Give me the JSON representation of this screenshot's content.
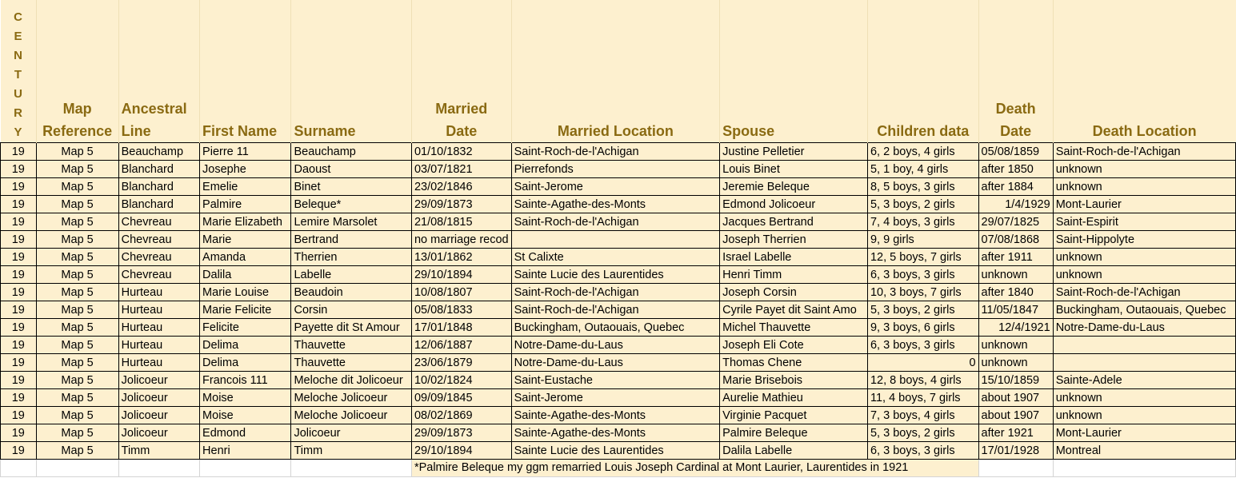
{
  "header": {
    "century_letters": [
      "C",
      "E",
      "N",
      "T",
      "U",
      "R",
      "Y"
    ],
    "map_reference": [
      "Map",
      "Reference"
    ],
    "ancestral_line": [
      "Ancestral",
      "Line"
    ],
    "first_name": "First Name",
    "surname": "Surname",
    "married_date": [
      "Married",
      "Date"
    ],
    "married_location": "Married Location",
    "spouse": "Spouse",
    "children_data": "Children data",
    "death_date": [
      "Death",
      "Date"
    ],
    "death_location": "Death Location"
  },
  "rows": [
    {
      "century": "19",
      "map": "Map 5",
      "line": "Beauchamp",
      "first": "Pierre 11",
      "surname": "Beauchamp",
      "mdate": "01/10/1832",
      "mloc": "Saint-Roch-de-l'Achigan",
      "spouse": "Justine Pelletier",
      "children": "6, 2 boys, 4 girls",
      "ddate": "05/08/1859",
      "dloc": "Saint-Roch-de-l'Achigan"
    },
    {
      "century": "19",
      "map": "Map 5",
      "line": "Blanchard",
      "first": "Josephe",
      "surname": "Daoust",
      "mdate": "03/07/1821",
      "mloc": "Pierrefonds",
      "spouse": "Louis Binet",
      "children": "5, 1 boy, 4 girls",
      "ddate": "after 1850",
      "dloc": "unknown"
    },
    {
      "century": "19",
      "map": "Map 5",
      "line": "Blanchard",
      "first": "Emelie",
      "surname": "Binet",
      "mdate": "23/02/1846",
      "mloc": "Saint-Jerome",
      "spouse": "Jeremie Beleque",
      "children": "8, 5 boys, 3 girls",
      "ddate": "after 1884",
      "dloc": "unknown"
    },
    {
      "century": "19",
      "map": "Map 5",
      "line": "Blanchard",
      "first": "Palmire",
      "surname": "Beleque*",
      "mdate": "29/09/1873",
      "mloc": "Sainte-Agathe-des-Monts",
      "spouse": "Edmond Jolicoeur",
      "children": "5, 3 boys, 2 girls",
      "ddate": "1/4/1929",
      "dloc": "Mont-Laurier"
    },
    {
      "century": "19",
      "map": "Map 5",
      "line": "Chevreau",
      "first": "Marie Elizabeth",
      "surname": "Lemire Marsolet",
      "mdate": "21/08/1815",
      "mloc": "Saint-Roch-de-l'Achigan",
      "spouse": "Jacques Bertrand",
      "children": "7, 4 boys, 3 girls",
      "ddate": "29/07/1825",
      "dloc": "Saint-Espirit"
    },
    {
      "century": "19",
      "map": "Map 5",
      "line": "Chevreau",
      "first": "Marie",
      "surname": "Bertrand",
      "mdate": "no marriage recod",
      "mloc": "",
      "spouse": "Joseph Therrien",
      "children": "9, 9 girls",
      "ddate": "07/08/1868",
      "dloc": "Saint-Hippolyte"
    },
    {
      "century": "19",
      "map": "Map 5",
      "line": "Chevreau",
      "first": "Amanda",
      "surname": "Therrien",
      "mdate": "13/01/1862",
      "mloc": "St Calixte",
      "spouse": "Israel Labelle",
      "children": "12, 5 boys, 7 girls",
      "ddate": "after 1911",
      "dloc": "unknown"
    },
    {
      "century": "19",
      "map": "Map 5",
      "line": "Chevreau",
      "first": "Dalila",
      "surname": "Labelle",
      "mdate": "29/10/1894",
      "mloc": "Sainte Lucie des Laurentides",
      "spouse": "Henri Timm",
      "children": "6, 3 boys, 3 girls",
      "ddate": "unknown",
      "dloc": "unknown"
    },
    {
      "century": "19",
      "map": "Map 5",
      "line": "Hurteau",
      "first": "Marie Louise",
      "surname": "Beaudoin",
      "mdate": "10/08/1807",
      "mloc": "Saint-Roch-de-l'Achigan",
      "spouse": "Joseph Corsin",
      "children": "10, 3 boys, 7 girls",
      "ddate": "after 1840",
      "dloc": "Saint-Roch-de-l'Achigan"
    },
    {
      "century": "19",
      "map": "Map 5",
      "line": "Hurteau",
      "first": "Marie Felicite",
      "surname": "Corsin",
      "mdate": "05/08/1833",
      "mloc": "Saint-Roch-de-l'Achigan",
      "spouse": "Cyrile Payet dit Saint Amo",
      "children": "5, 3 boys, 2 girls",
      "ddate": "11/05/1847",
      "dloc": "Buckingham, Outaouais, Quebec"
    },
    {
      "century": "19",
      "map": "Map 5",
      "line": "Hurteau",
      "first": "Felicite",
      "surname": "Payette  dit St Amour",
      "mdate": "17/01/1848",
      "mloc": "Buckingham, Outaouais, Quebec",
      "spouse": "Michel Thauvette",
      "children": "9, 3 boys, 6 girls",
      "ddate": "12/4/1921",
      "dloc": "Notre-Dame-du-Laus"
    },
    {
      "century": "19",
      "map": "Map 5",
      "line": "Hurteau",
      "first": "Delima",
      "surname": "Thauvette",
      "mdate": "12/06/1887",
      "mloc": "Notre-Dame-du-Laus",
      "spouse": "Joseph Eli Cote",
      "children": "6, 3 boys, 3 girls",
      "ddate": "unknown",
      "dloc": ""
    },
    {
      "century": "19",
      "map": "Map 5",
      "line": "Hurteau",
      "first": "Delima",
      "surname": "Thauvette",
      "mdate": "23/06/1879",
      "mloc": "Notre-Dame-du-Laus",
      "spouse": "Thomas Chene",
      "children": "0",
      "ddate": "unknown",
      "dloc": ""
    },
    {
      "century": "19",
      "map": "Map 5",
      "line": "Jolicoeur",
      "first": "Francois 111",
      "surname": "Meloche dit Jolicoeur",
      "mdate": "10/02/1824",
      "mloc": "Saint-Eustache",
      "spouse": "Marie Brisebois",
      "children": "12, 8 boys, 4 girls",
      "ddate": "15/10/1859",
      "dloc": "Sainte-Adele"
    },
    {
      "century": "19",
      "map": "Map 5",
      "line": "Jolicoeur",
      "first": "Moise",
      "surname": "Meloche Jolicoeur",
      "mdate": "09/09/1845",
      "mloc": "Saint-Jerome",
      "spouse": "Aurelie Mathieu",
      "children": "11, 4 boys, 7 girls",
      "ddate": "about 1907",
      "dloc": "unknown"
    },
    {
      "century": "19",
      "map": "Map 5",
      "line": "Jolicoeur",
      "first": "Moise",
      "surname": "Meloche Jolicoeur",
      "mdate": "08/02/1869",
      "mloc": "Sainte-Agathe-des-Monts",
      "spouse": "Virginie Pacquet",
      "children": "7, 3 boys, 4 girls",
      "ddate": "about 1907",
      "dloc": "unknown"
    },
    {
      "century": "19",
      "map": "Map 5",
      "line": "Jolicoeur",
      "first": "Edmond",
      "surname": "Jolicoeur",
      "mdate": "29/09/1873",
      "mloc": "Sainte-Agathe-des-Monts",
      "spouse": "Palmire Beleque",
      "children": "5, 3 boys, 2 girls",
      "ddate": "after 1921",
      "dloc": "Mont-Laurier"
    },
    {
      "century": "19",
      "map": "Map 5",
      "line": "Timm",
      "first": "Henri",
      "surname": "Timm",
      "mdate": "29/10/1894",
      "mloc": "Sainte Lucie des Laurentides",
      "spouse": "Dalila Labelle",
      "children": "6, 3 boys, 3 girls",
      "ddate": "17/01/1928",
      "dloc": "Montreal"
    }
  ],
  "note": "*Palmire Beleque my ggm remarried Louis Joseph Cardinal at Mont Laurier, Laurentides in 1921",
  "colors": {
    "header_bg": "#fdf0cf",
    "header_text": "#8a6a12",
    "border": "#000000"
  }
}
